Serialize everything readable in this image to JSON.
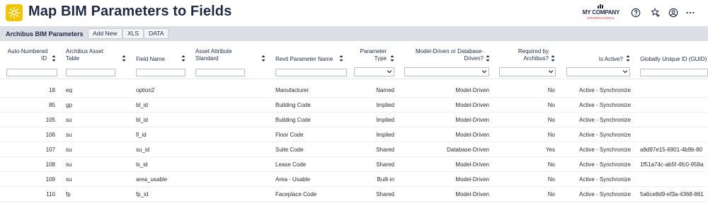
{
  "header": {
    "title": "Map BIM Parameters to Fields",
    "app_icon": "gear-icon",
    "logo_main": "MY COMPANY",
    "logo_sub": "INTERNATIONAL",
    "icons": [
      "help-icon",
      "favorite-icon",
      "user-icon",
      "more-icon"
    ]
  },
  "toolbar": {
    "panel_title": "Archibus BIM Parameters",
    "add_new": "Add New",
    "xls": "XLS",
    "data": "DATA"
  },
  "columns": {
    "auto_id": [
      "Auto-Numbered",
      "ID"
    ],
    "asset_table": [
      "Archibus Asset",
      "Table"
    ],
    "field_name": [
      "Field Name"
    ],
    "attr_standard": [
      "Asset Attribute",
      "Standard"
    ],
    "revit_param": [
      "Revit Parameter Name"
    ],
    "param_type": [
      "Parameter",
      "Type"
    ],
    "model_driven": [
      "Model-Driven or Database-",
      "Driven?"
    ],
    "required": [
      "Required by",
      "Archibus?"
    ],
    "is_active": [
      "Is Active?"
    ],
    "guid": [
      "Globally Unique ID (GUID)"
    ]
  },
  "rows": [
    {
      "id": "18",
      "table": "eq",
      "field": "option2",
      "attr": "",
      "revit": "Manufacturer",
      "ptype": "Named",
      "driven": "Model-Driven",
      "required": "No",
      "active": "Active - Synchronize",
      "guid": ""
    },
    {
      "id": "85",
      "table": "gp",
      "field": "bl_id",
      "attr": "",
      "revit": "Building Code",
      "ptype": "Implied",
      "driven": "Model-Driven",
      "required": "No",
      "active": "Active - Synchronize",
      "guid": ""
    },
    {
      "id": "105",
      "table": "su",
      "field": "bl_id",
      "attr": "",
      "revit": "Building Code",
      "ptype": "Implied",
      "driven": "Model-Driven",
      "required": "No",
      "active": "Active - Synchronize",
      "guid": ""
    },
    {
      "id": "106",
      "table": "su",
      "field": "fl_id",
      "attr": "",
      "revit": "Floor Code",
      "ptype": "Implied",
      "driven": "Model-Driven",
      "required": "No",
      "active": "Active - Synchronize",
      "guid": ""
    },
    {
      "id": "107",
      "table": "su",
      "field": "su_id",
      "attr": "",
      "revit": "Suite Code",
      "ptype": "Shared",
      "driven": "Database-Driven",
      "required": "Yes",
      "active": "Active - Synchronize",
      "guid": "a8d97e15-6901-4b9b-80"
    },
    {
      "id": "108",
      "table": "su",
      "field": "ls_id",
      "attr": "",
      "revit": "Lease Code",
      "ptype": "Shared",
      "driven": "Model-Driven",
      "required": "No",
      "active": "Active - Synchronize",
      "guid": "1f51a74c-ab5f-4fc0-958a"
    },
    {
      "id": "109",
      "table": "su",
      "field": "area_usable",
      "attr": "",
      "revit": "Area - Usable",
      "ptype": "Built-in",
      "driven": "Model-Driven",
      "required": "No",
      "active": "Active - Synchronize",
      "guid": ""
    },
    {
      "id": "110",
      "table": "fp",
      "field": "fp_id",
      "attr": "",
      "revit": "Faceplace Code",
      "ptype": "Shared",
      "driven": "Model-Driven",
      "required": "No",
      "active": "Active - Synchronize",
      "guid": "5a6ce8d9-ef3a-4368-861"
    }
  ]
}
